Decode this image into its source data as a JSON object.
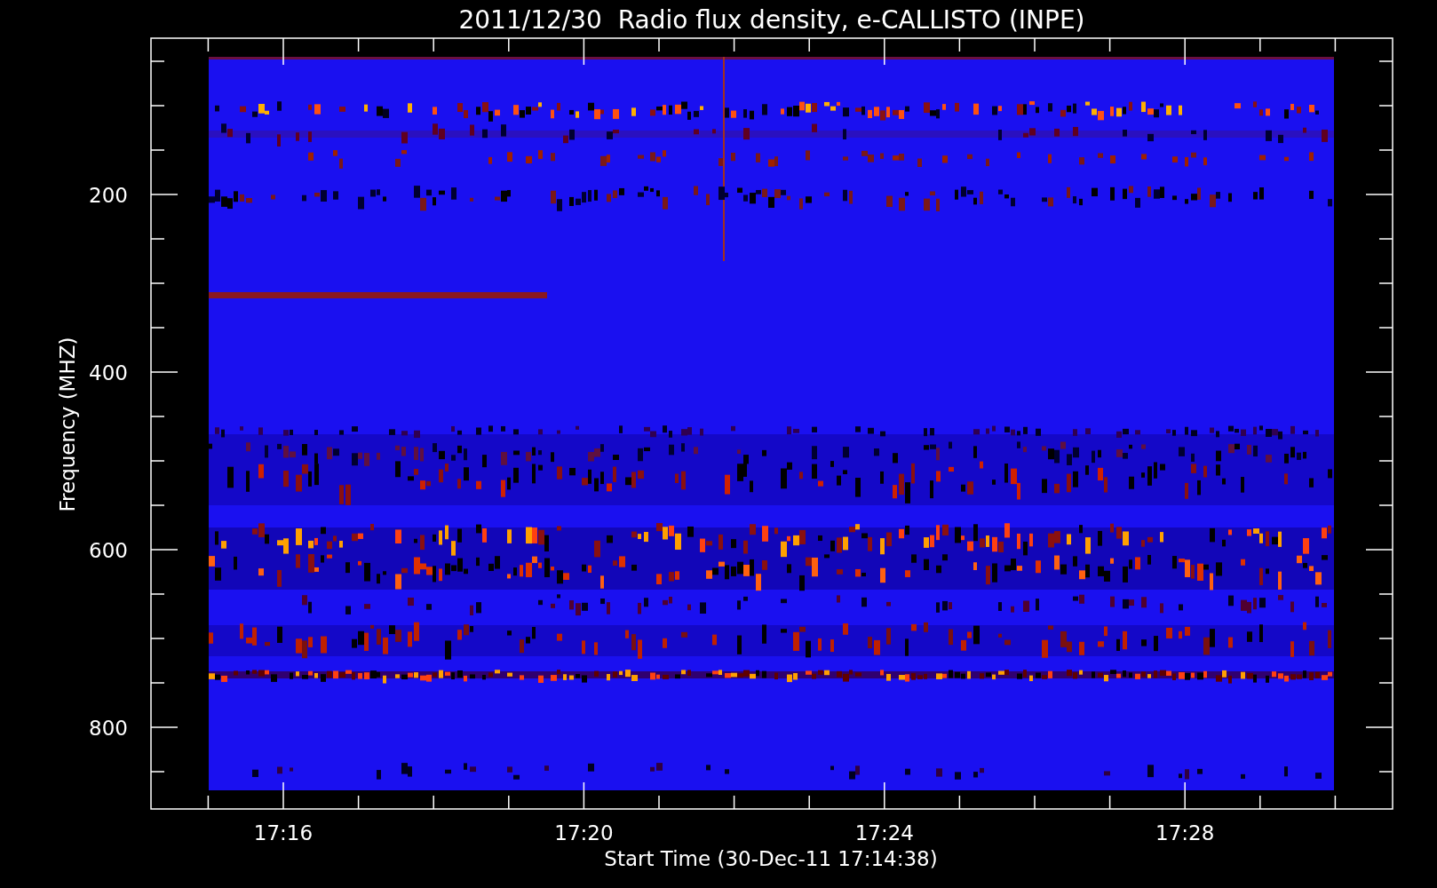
{
  "title": "2011/12/30  Radio flux density, e-CALLISTO (INPE)",
  "y_axis": {
    "label": "Frequency (MHZ)",
    "ticks": [
      "200",
      "400",
      "600",
      "800"
    ]
  },
  "x_axis": {
    "label": "Start Time (30-Dec-11 17:14:38)",
    "ticks": [
      "17:16",
      "17:20",
      "17:24",
      "17:28"
    ]
  }
}
